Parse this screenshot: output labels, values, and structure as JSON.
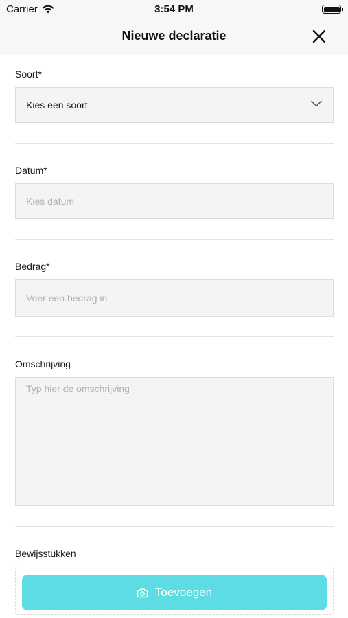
{
  "status_bar": {
    "carrier": "Carrier",
    "time": "3:54 PM"
  },
  "header": {
    "title": "Nieuwe declaratie",
    "close_icon": "close-icon"
  },
  "form": {
    "soort": {
      "label": "Soort*",
      "value": "Kies een soort"
    },
    "datum": {
      "label": "Datum*",
      "placeholder": "Kies datum"
    },
    "bedrag": {
      "label": "Bedrag*",
      "placeholder": "Voer een bedrag in"
    },
    "omschrijving": {
      "label": "Omschrijving",
      "placeholder": "Typ hier de omschrijving"
    },
    "bewijsstukken": {
      "label": "Bewijsstukken",
      "button_label": "Toevoegen",
      "button_icon": "camera-icon"
    }
  },
  "colors": {
    "accent": "#5ddde3",
    "field_bg": "#f4f4f4",
    "header_bg": "#f7f7f7"
  }
}
